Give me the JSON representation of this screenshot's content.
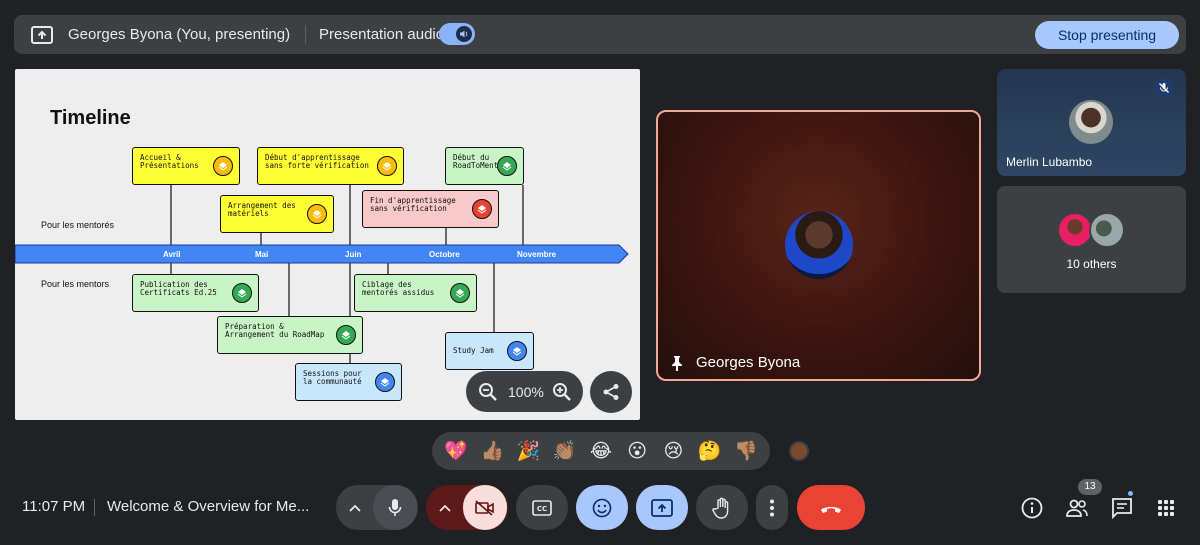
{
  "top_bar": {
    "presenter": "Georges Byona (You, presenting)",
    "audio_label": "Presentation audio",
    "stop_label": "Stop presenting"
  },
  "slide": {
    "title": "Timeline",
    "row_mentees": "Pour les mentorés",
    "row_mentors": "Pour les mentors",
    "months": [
      "Avril",
      "Mai",
      "Juin",
      "Octobre",
      "Novembre"
    ],
    "cards": [
      {
        "text": "Accueil &\nPrésentations",
        "color": "yellow"
      },
      {
        "text": "Début d'apprentissage\nsans forte vérification",
        "color": "yellow"
      },
      {
        "text": "Début du\nRoadToMentor",
        "color": "green"
      },
      {
        "text": "Arrangement des\nmatériels",
        "color": "yellow"
      },
      {
        "text": "Fin d'apprentissage\nsans vérification",
        "color": "pink"
      },
      {
        "text": "Publication des\nCertificats Ed.25",
        "color": "green"
      },
      {
        "text": "Ciblage des\nmentorés assidus",
        "color": "green"
      },
      {
        "text": "Préparation &\nArrangement du RoadMap",
        "color": "green"
      },
      {
        "text": "Study Jam",
        "color": "blue"
      },
      {
        "text": "Sessions pour\nla communauté",
        "color": "blue"
      }
    ],
    "zoom": "100%"
  },
  "participants": {
    "main_name": "Georges Byona",
    "side1_name": "Merlin Lubambo",
    "others_label": "10 others"
  },
  "reactions": [
    "💖",
    "👍🏽",
    "🎉",
    "👏🏽",
    "😂",
    "😮",
    "😢",
    "🤔",
    "👎🏽"
  ],
  "bottom_bar": {
    "time": "11:07 PM",
    "meeting_title": "Welcome & Overview for Me...",
    "people_count": "13"
  },
  "colors": {
    "accent": "#a8c7fa",
    "end_call": "#ea4335",
    "timeline_bar": "#4285f4"
  }
}
